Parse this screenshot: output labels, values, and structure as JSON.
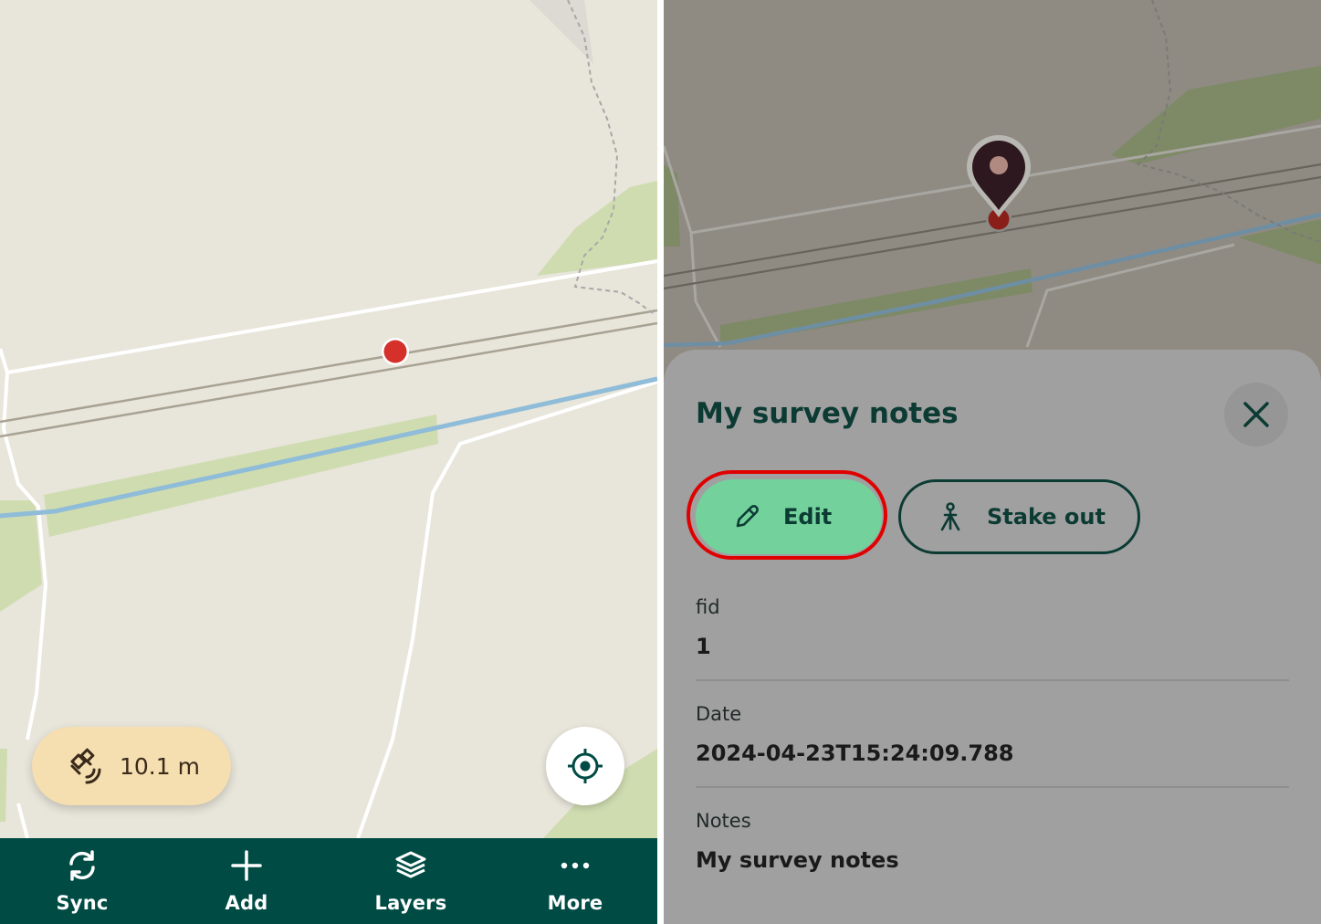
{
  "left_screen": {
    "gps": {
      "accuracy": "10.1 m",
      "icon": "satellite-signal-icon"
    },
    "locate_icon": "crosshair-target-icon",
    "nav": {
      "items": [
        {
          "label": "Sync",
          "icon": "sync-icon"
        },
        {
          "label": "Add",
          "icon": "plus-icon"
        },
        {
          "label": "Layers",
          "icon": "layers-icon"
        },
        {
          "label": "More",
          "icon": "more-dots-icon"
        }
      ]
    }
  },
  "right_screen": {
    "drawer": {
      "title": "My survey notes",
      "close_icon": "close-icon",
      "edit_label": "Edit",
      "edit_icon": "pencil-icon",
      "stakeout_label": "Stake out",
      "stakeout_icon": "surveyor-tripod-icon",
      "fields": [
        {
          "label": "fid",
          "value": "1"
        },
        {
          "label": "Date",
          "value": "2024-04-23T15:24:09.788"
        },
        {
          "label": "Notes",
          "value": "My survey notes"
        }
      ]
    }
  },
  "colors": {
    "map_background": "#e8e5da",
    "primary_dark_green": "#004c45",
    "accent_green": "#73d19c",
    "gps_pill": "#f5deb0",
    "highlight_red": "#e00000",
    "feature_point": "#d5302a"
  }
}
